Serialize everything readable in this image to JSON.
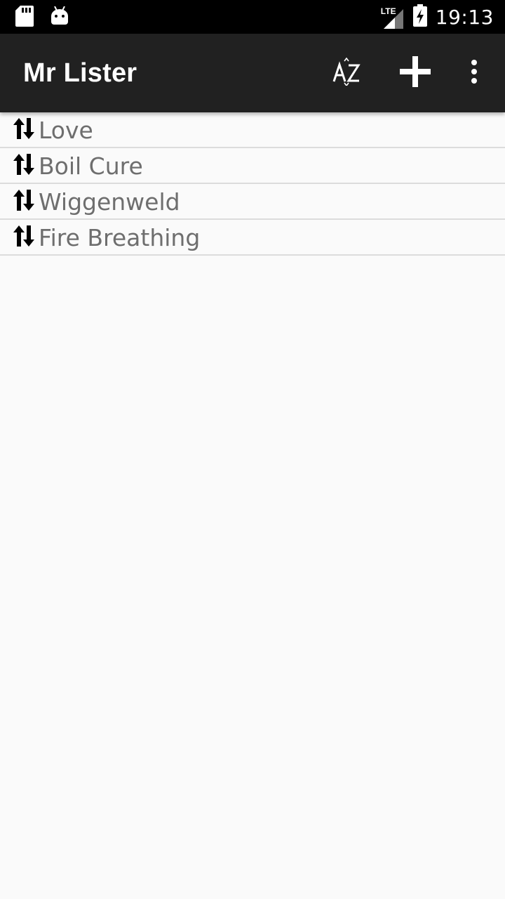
{
  "status_bar": {
    "time": "19:13",
    "network": "LTE",
    "icons": [
      "sd-card-icon",
      "android-debug-icon",
      "signal-icon",
      "battery-charging-icon"
    ]
  },
  "toolbar": {
    "title": "Mr Lister",
    "actions": [
      "sort-az-icon",
      "add-icon",
      "overflow-menu-icon"
    ]
  },
  "list": {
    "items": [
      {
        "label": "Love"
      },
      {
        "label": "Boil Cure"
      },
      {
        "label": "Wiggenweld"
      },
      {
        "label": "Fire Breathing"
      }
    ]
  }
}
